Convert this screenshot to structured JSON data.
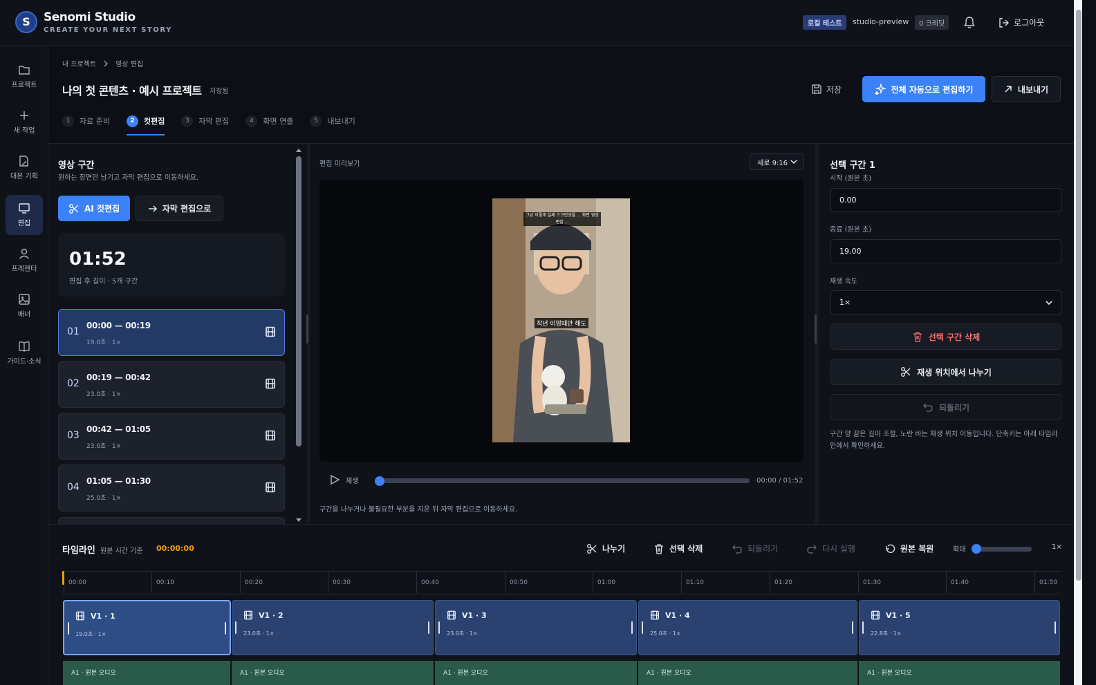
{
  "app": {
    "brand_mark": "S",
    "brand_name": "Senomi Studio",
    "brand_tagline": "CREATE YOUR NEXT STORY",
    "login_badge": "로컬 테스트",
    "account": "studio-preview",
    "credits": "0 크레딧",
    "logout_label": "로그아웃"
  },
  "nav": [
    {
      "label": "프로젝트",
      "icon": "folder-icon"
    },
    {
      "label": "새 작업",
      "icon": "plus-icon"
    },
    {
      "label": "대본 기획",
      "icon": "script-icon"
    },
    {
      "label": "편집",
      "icon": "edit-icon",
      "active": true
    },
    {
      "label": "프레젠터",
      "icon": "person-icon"
    },
    {
      "label": "배너",
      "icon": "image-icon"
    },
    {
      "label": "가이드·소식",
      "icon": "book-icon"
    }
  ],
  "header": {
    "breadcrumb": [
      "내 프로젝트",
      "영상 편집"
    ],
    "title": "나의 첫 콘텐츠 · 예시 프로젝트",
    "saved": "저장됨",
    "save_label": "저장",
    "auto_edit_label": "전체 자동으로 편집하기",
    "export_label": "내보내기"
  },
  "steps": [
    {
      "num": "1",
      "label": "자료 준비"
    },
    {
      "num": "2",
      "label": "컷편집",
      "active": true
    },
    {
      "num": "3",
      "label": "자막 편집"
    },
    {
      "num": "4",
      "label": "화면 연출"
    },
    {
      "num": "5",
      "label": "내보내기"
    }
  ],
  "segments_panel": {
    "title": "영상 구간",
    "description": "원하는 장면만 남기고 자막 편집으로 이동하세요.",
    "ai_cut_label": "AI 컷편집",
    "to_subtitle_label": "자막 편집으로",
    "duration": "01:52",
    "duration_caption": "편집 후 길이 · 5개 구간",
    "segments": [
      {
        "idx": "01",
        "range": "00:00 — 00:19",
        "meta": "19.0초 · 1×"
      },
      {
        "idx": "02",
        "range": "00:19 — 00:42",
        "meta": "23.0초 · 1×"
      },
      {
        "idx": "03",
        "range": "00:42 — 01:05",
        "meta": "23.0초 · 1×"
      },
      {
        "idx": "04",
        "range": "01:05 — 01:30",
        "meta": "25.0초 · 1×"
      }
    ]
  },
  "preview": {
    "label": "편집 미리보기",
    "ratio": "세로 9:16",
    "caption_top": "그냥 이렇게 실제 스크린샷을 ... 화면 영상 편집 ...",
    "caption_mid": "작년 이맘때만 해도",
    "play_label": "재생",
    "time": "00:00 / 01:52",
    "progress": 0.0,
    "hint": "구간을 나누거나 불필요한 부분을 지운 뒤 자막 편집으로 이동하세요."
  },
  "selection": {
    "title": "선택 구간 1",
    "start_label": "시작 (원본 초)",
    "start_value": "0.00",
    "end_label": "종료 (원본 초)",
    "end_value": "19.00",
    "speed_label": "재생 속도",
    "speed_value": "1×",
    "delete_label": "선택 구간 삭제",
    "split_label": "재생 위치에서 나누기",
    "undo_label": "되돌리기",
    "help": "구간 양 끝은 길이 조절, 노란 바는 재생 위치 이동입니다. 단축키는 아래 타임라인에서 확인하세요."
  },
  "timeline": {
    "title": "타임라인",
    "basis": "원본 시간 기준",
    "time": "00:00:00",
    "tools": {
      "split": "나누기",
      "delete": "선택 삭제",
      "undo": "되돌리기",
      "redo": "다시 실행",
      "restore": "원본 복원"
    },
    "zoom_label": "확대",
    "zoom_value": "1×",
    "zoom_level": 0.0,
    "ticks": [
      "00:00",
      "00:10",
      "00:20",
      "00:30",
      "00:40",
      "00:50",
      "01:00",
      "01:10",
      "01:20",
      "01:30",
      "01:40",
      "01:50"
    ],
    "clips": [
      {
        "name": "V1 · 1",
        "meta": "19.0초 · 1×",
        "active": true
      },
      {
        "name": "V1 · 2",
        "meta": "23.0초 · 1×"
      },
      {
        "name": "V1 · 3",
        "meta": "23.0초 · 1×"
      },
      {
        "name": "V1 · 4",
        "meta": "25.0초 · 1×"
      },
      {
        "name": "V1 · 5",
        "meta": "22.8초 · 1×"
      }
    ],
    "audio_label": "A1 · 원본 오디오"
  }
}
